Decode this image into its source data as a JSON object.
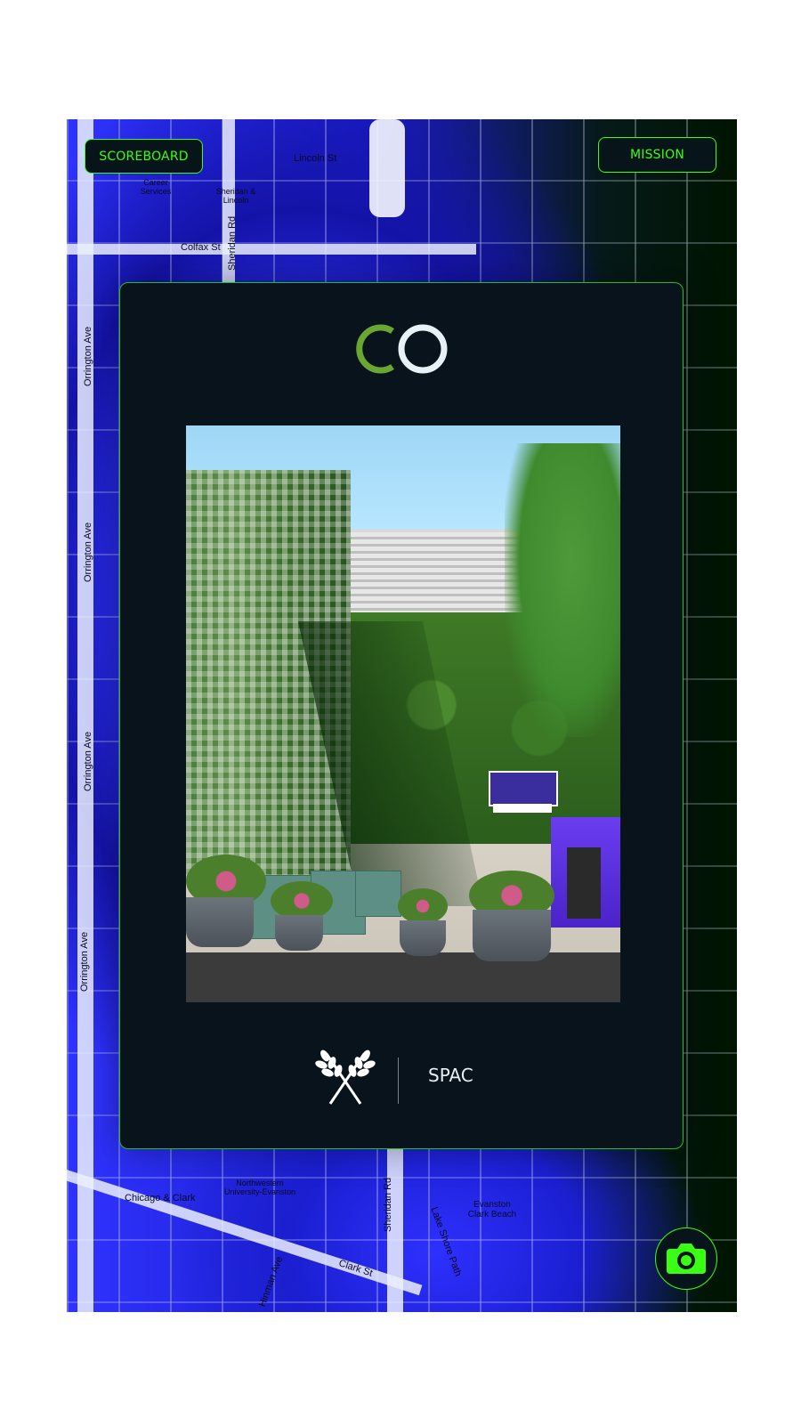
{
  "header": {
    "scoreboard_label": "SCOREBOARD",
    "mission_label": "MISSION"
  },
  "map": {
    "streets": [
      "Lincoln St",
      "Colfax St",
      "Orrington Ave",
      "Sheridan Rd",
      "Clark St",
      "Hinman Ave",
      "Lake Shore Path",
      "Chicago & Clark",
      "Northwestern University-Evanston",
      "Evanston Clark Beach",
      "Career Services",
      "Sheridan & Lincoln"
    ]
  },
  "card": {
    "location_name": "SPAC",
    "logo_icon": "double-ring-logo",
    "footer_icon": "crossed-wheat-icon"
  },
  "camera": {
    "icon": "camera-icon",
    "color": "#39ff14"
  },
  "colors": {
    "accent": "#39ff14",
    "card_bg": "#08131c",
    "logo_green": "#6aa632",
    "logo_white": "#e8f1f5"
  }
}
